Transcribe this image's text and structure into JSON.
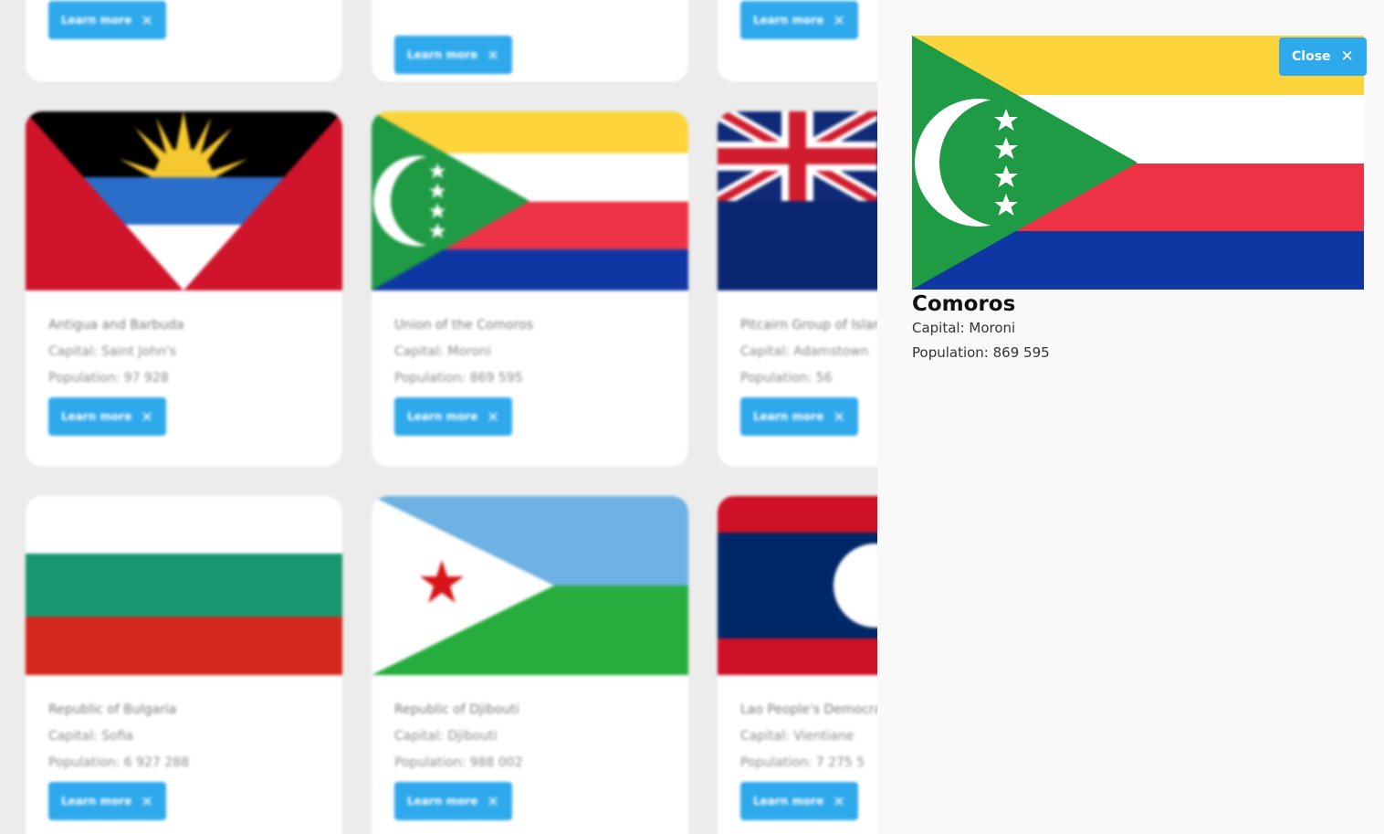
{
  "grid": {
    "button_label": "Learn more",
    "close_glyph": "✕",
    "cards": [
      {
        "flag": "antigua-and-barbuda",
        "name": "Antigua and Barbuda",
        "capital": "Capital: Saint John's",
        "population": "Population: 97 928"
      },
      {
        "flag": "comoros",
        "name": "Union of the Comoros",
        "capital": "Capital: Moroni",
        "population": "Population: 869 595"
      },
      {
        "flag": "pitcairn-islands",
        "name": "Pitcairn Group of Islands",
        "capital": "Capital: Adamstown",
        "population": "Population: 56"
      },
      {
        "flag": "bulgaria",
        "name": "Republic of Bulgaria",
        "capital": "Capital: Sofia",
        "population": "Population: 6 927 288"
      },
      {
        "flag": "djibouti",
        "name": "Republic of Djibouti",
        "capital": "Capital: Djibouti",
        "population": "Population: 988 002"
      },
      {
        "flag": "laos",
        "name": "Lao People's Democratic Republic",
        "capital": "Capital: Vientiane",
        "population": "Population: 7 275 5"
      }
    ]
  },
  "detail": {
    "close_label": "Close",
    "close_glyph": "✕",
    "flag": "comoros",
    "title": "Comoros",
    "capital": "Capital: Moroni",
    "population": "Population: 869 595"
  },
  "colors": {
    "accent": "#2ea9ec",
    "page_background": "#ececec",
    "panel_background": "#f9f9f9",
    "card_background": "#ffffff"
  }
}
